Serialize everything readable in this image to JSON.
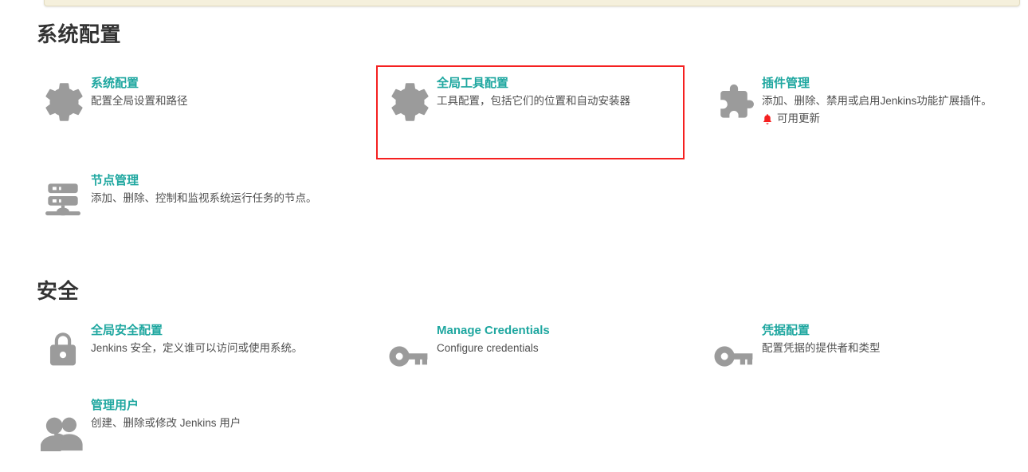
{
  "notification_bar": {
    "visible": true,
    "color": "#f5f0dc"
  },
  "theme": {
    "link_color": "#1fa7a0",
    "heading_color": "#333333",
    "icon_color": "#9b9b9b",
    "alert_color": "#f52020",
    "description_color": "#505050"
  },
  "sections": [
    {
      "id": "system-configuration",
      "title": "系统配置",
      "items": [
        {
          "id": "configure-system",
          "icon": "gear-icon",
          "title": "系统配置",
          "description": "配置全局设置和路径",
          "badge": null,
          "highlighted": false
        },
        {
          "id": "global-tool-configuration",
          "icon": "gear-icon",
          "title": "全局工具配置",
          "description": "工具配置，包括它们的位置和自动安装器",
          "badge": null,
          "highlighted": true
        },
        {
          "id": "manage-plugins",
          "icon": "plugin-icon",
          "title": "插件管理",
          "description": "添加、删除、禁用或启用Jenkins功能扩展插件。",
          "badge": {
            "icon": "bell-icon",
            "label": "可用更新",
            "color": "#f52020"
          },
          "highlighted": false
        },
        {
          "id": "manage-nodes",
          "icon": "server-icon",
          "title": "节点管理",
          "description": "添加、删除、控制和监视系统运行任务的节点。",
          "badge": null,
          "highlighted": false
        }
      ]
    },
    {
      "id": "security",
      "title": "安全",
      "items": [
        {
          "id": "configure-global-security",
          "icon": "lock-icon",
          "title": "全局安全配置",
          "description": "Jenkins 安全，定义谁可以访问或使用系统。",
          "badge": null,
          "highlighted": false
        },
        {
          "id": "manage-credentials",
          "icon": "key-icon",
          "title": "Manage Credentials",
          "description": "Configure credentials",
          "badge": null,
          "highlighted": false
        },
        {
          "id": "configure-credentials",
          "icon": "key-icon",
          "title": "凭据配置",
          "description": "配置凭据的提供者和类型",
          "badge": null,
          "highlighted": false
        },
        {
          "id": "manage-users",
          "icon": "users-icon",
          "title": "管理用户",
          "description": "创建、删除或修改 Jenkins 用户",
          "badge": null,
          "highlighted": false
        }
      ]
    }
  ]
}
